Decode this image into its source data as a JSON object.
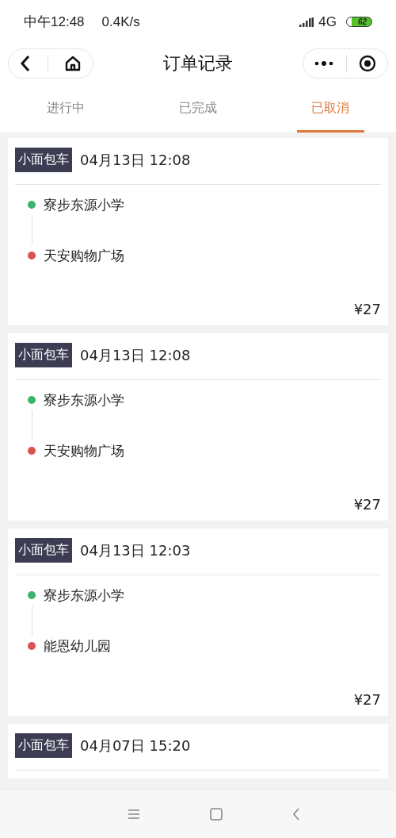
{
  "status_bar": {
    "time": "中午12:48",
    "speed": "0.4K/s",
    "network": "4G",
    "battery": "62"
  },
  "header": {
    "title": "订单记录"
  },
  "tabs": [
    {
      "label": "进行中",
      "selected": false
    },
    {
      "label": "已完成",
      "selected": false
    },
    {
      "label": "已取消",
      "selected": true
    }
  ],
  "orders": [
    {
      "tag": "小面包车",
      "datetime": "04月13日 12:08",
      "stops": [
        {
          "name": "寮步东源小学",
          "color": "#3cb46e"
        },
        {
          "name": "天安购物广场",
          "color": "#d9534f"
        }
      ],
      "price": "¥27"
    },
    {
      "tag": "小面包车",
      "datetime": "04月13日 12:08",
      "stops": [
        {
          "name": "寮步东源小学",
          "color": "#3cb46e"
        },
        {
          "name": "天安购物广场",
          "color": "#d9534f"
        }
      ],
      "price": "¥27"
    },
    {
      "tag": "小面包车",
      "datetime": "04月13日 12:03",
      "stops": [
        {
          "name": "寮步东源小学",
          "color": "#3cb46e"
        },
        {
          "name": "能恩幼儿园",
          "color": "#d9534f"
        }
      ],
      "price": "¥27"
    },
    {
      "tag": "小面包车",
      "datetime": "04月07日 15:20"
    }
  ]
}
